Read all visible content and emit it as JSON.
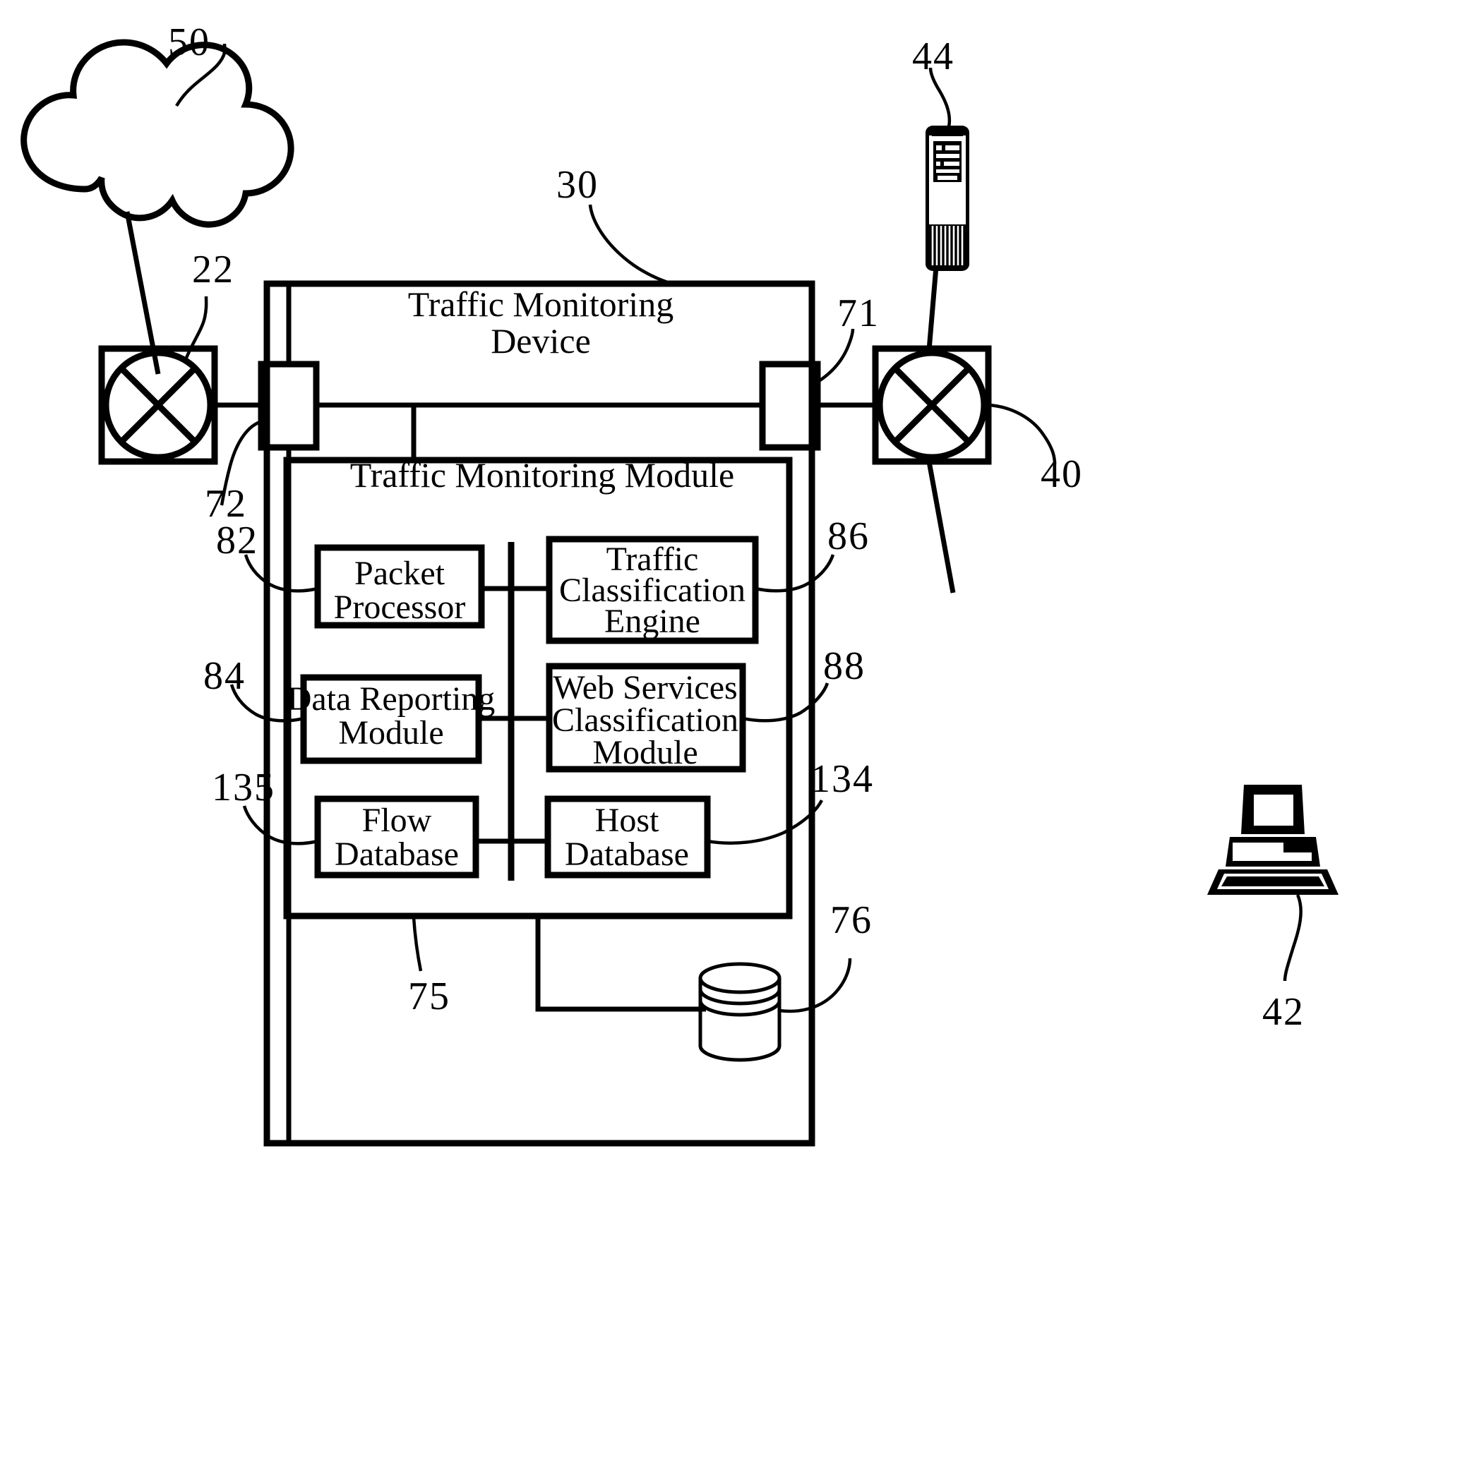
{
  "figure": {
    "type": "patent-block-diagram",
    "background_color": "#ffffff",
    "line_color": "#000000"
  },
  "outer": {
    "device_title_line1": "Traffic Monitoring",
    "device_title_line2": "Device",
    "device_ref": "30",
    "module_title": "Traffic Monitoring Module",
    "module_ref": "75"
  },
  "network": {
    "cloud_ref": "50",
    "left_router_ref": "22",
    "right_router_ref": "40",
    "server_ref": "44",
    "laptop_ref": "42",
    "left_port_ref": "72",
    "right_port_ref": "71"
  },
  "components": [
    {
      "ref": "82",
      "label_lines": [
        "Packet",
        "Processor"
      ],
      "side": "left"
    },
    {
      "ref": "86",
      "label_lines": [
        "Traffic",
        "Classification",
        "Engine"
      ],
      "side": "right"
    },
    {
      "ref": "84",
      "label_lines": [
        "Data Reporting",
        "Module"
      ],
      "side": "left"
    },
    {
      "ref": "88",
      "label_lines": [
        "Web Services",
        "Classification",
        "Module"
      ],
      "side": "right"
    },
    {
      "ref": "135",
      "label_lines": [
        "Flow",
        "Database"
      ],
      "side": "left"
    },
    {
      "ref": "134",
      "label_lines": [
        "Host",
        "Database"
      ],
      "side": "right"
    }
  ],
  "storage": {
    "ref": "76",
    "icon": "database-cylinder-icon"
  },
  "refs": {
    "r30": "30",
    "r22": "22",
    "r40": "40",
    "r42": "42",
    "r44": "44",
    "r50": "50",
    "r71": "71",
    "r72": "72",
    "r75": "75",
    "r76": "76",
    "r82": "82",
    "r84": "84",
    "r86": "86",
    "r88": "88",
    "r134": "134",
    "r135": "135"
  },
  "text": {
    "packet_processor_l1": "Packet",
    "packet_processor_l2": "Processor",
    "traffic_class_l1": "Traffic",
    "traffic_class_l2": "Classification",
    "traffic_class_l3": "Engine",
    "data_reporting_l1": "Data Reporting",
    "data_reporting_l2": "Module",
    "web_services_l1": "Web Services",
    "web_services_l2": "Classification",
    "web_services_l3": "Module",
    "flow_db_l1": "Flow",
    "flow_db_l2": "Database",
    "host_db_l1": "Host",
    "host_db_l2": "Database",
    "device_title_l1": "Traffic Monitoring",
    "device_title_l2": "Device",
    "module_title": "Traffic Monitoring Module"
  }
}
